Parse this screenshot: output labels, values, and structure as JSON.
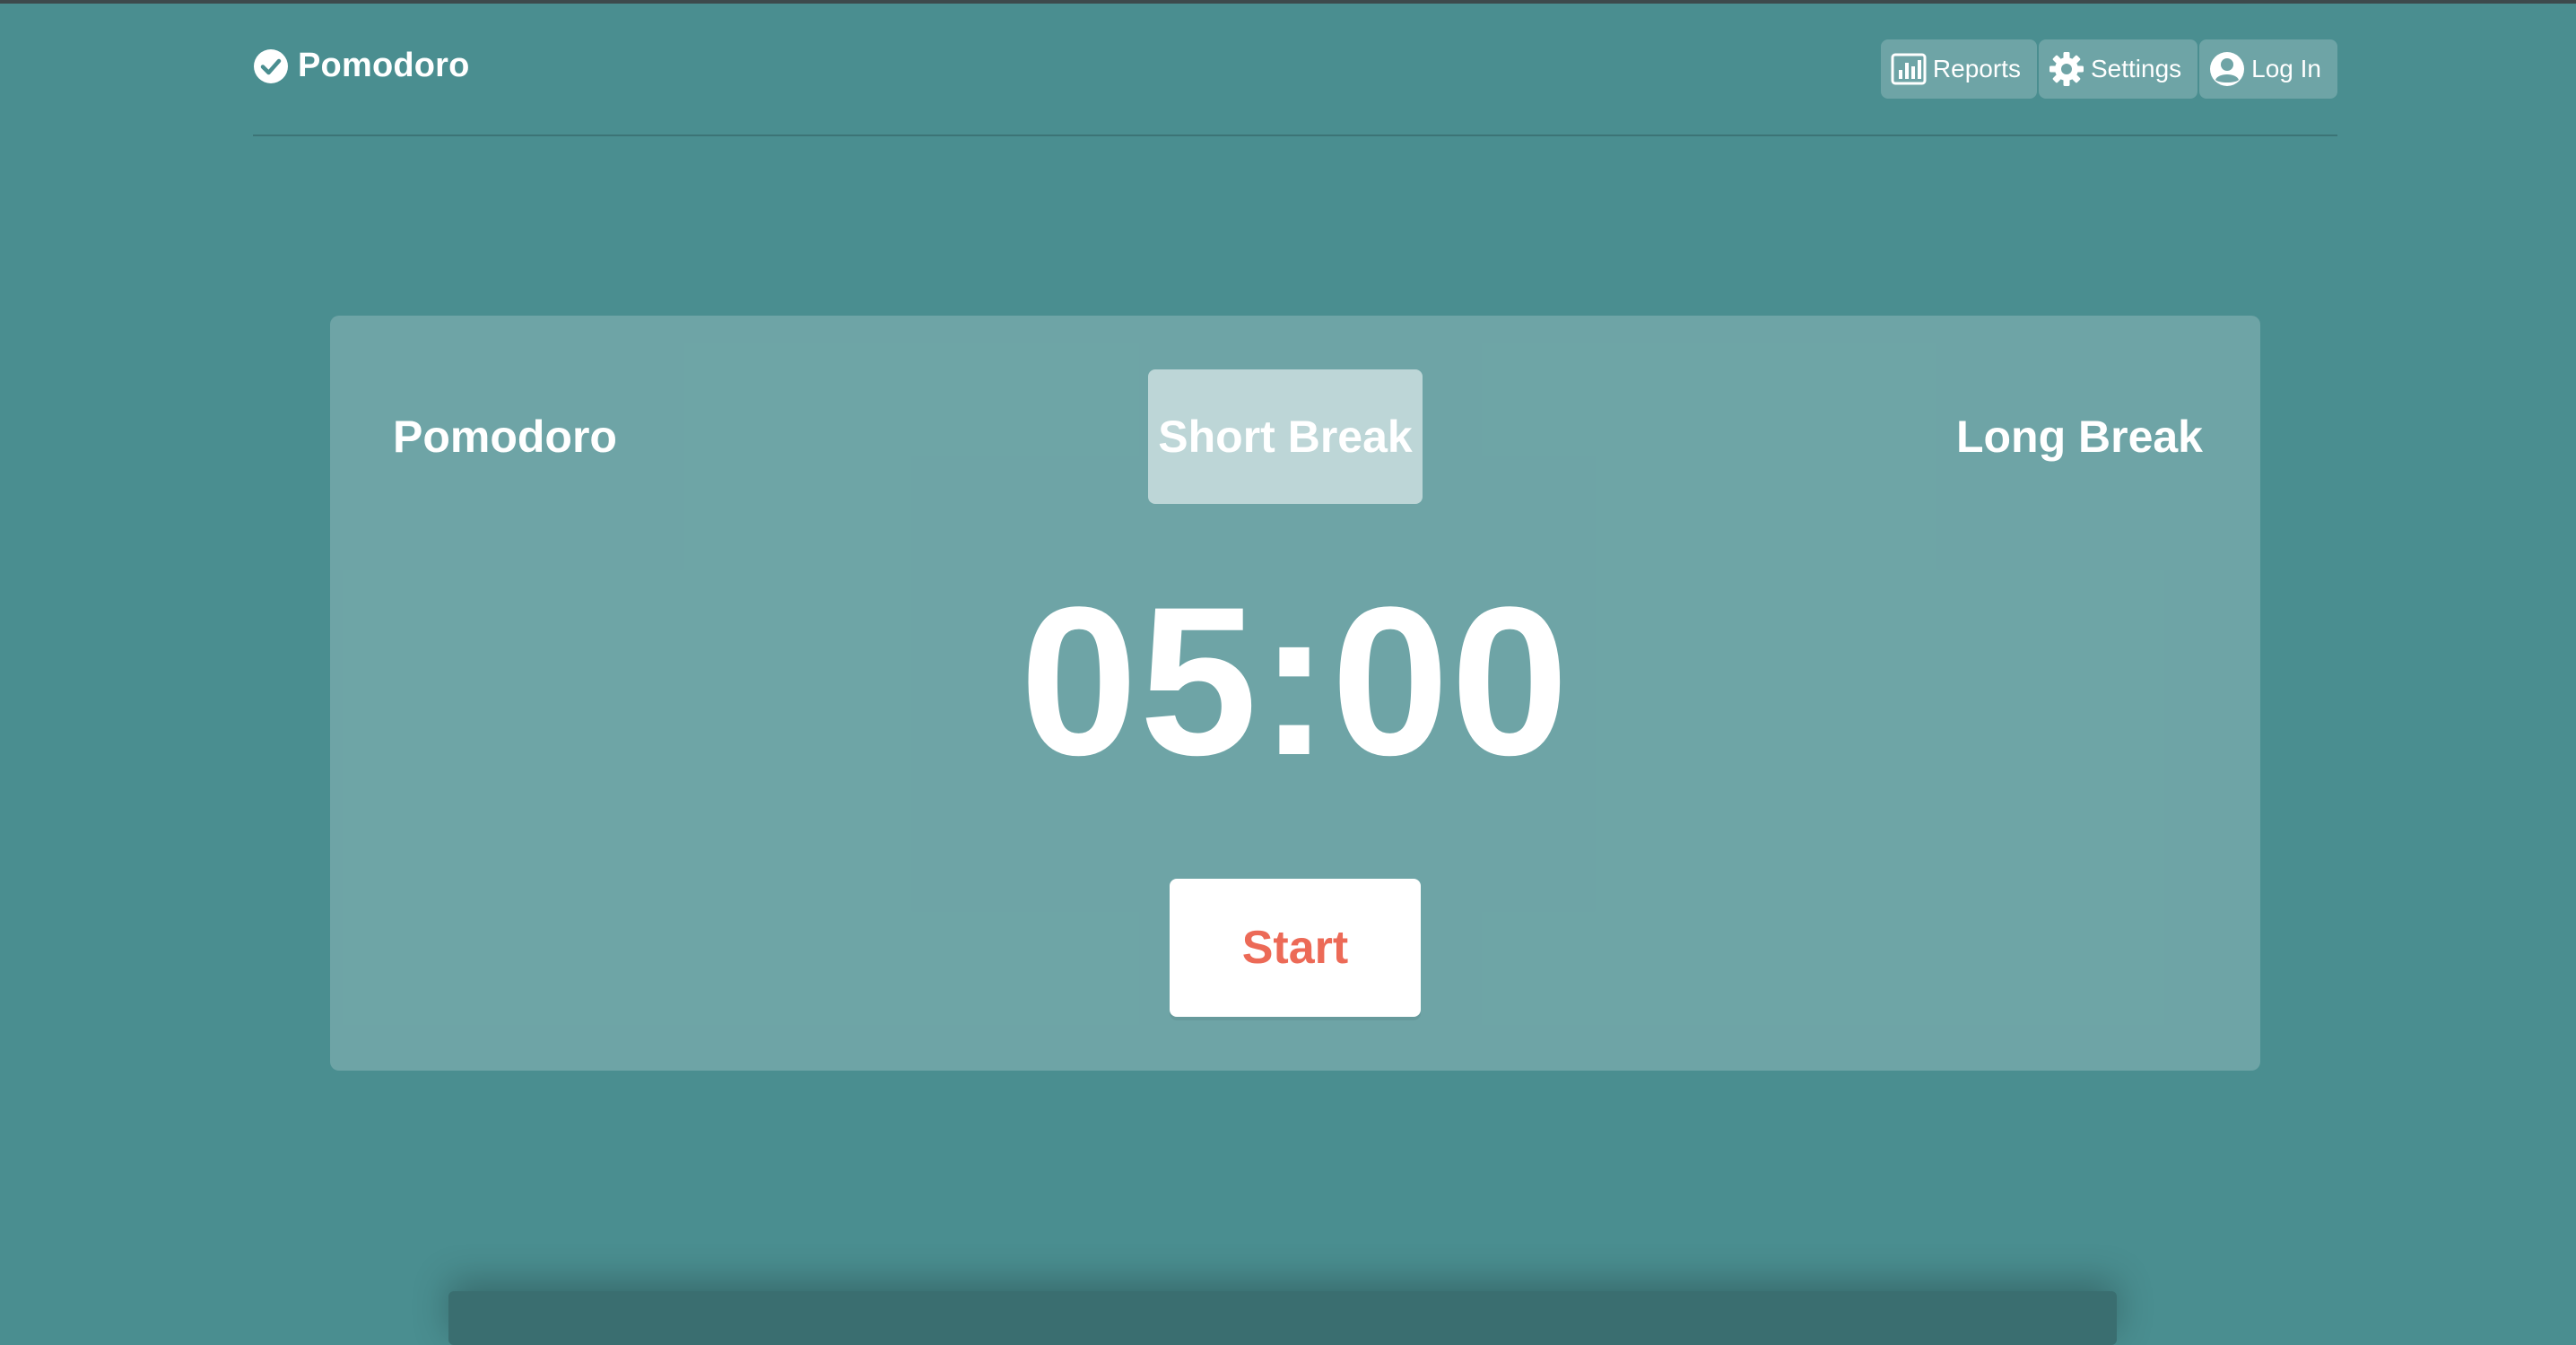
{
  "brand": {
    "title": "Pomodoro",
    "icon": "check-circle-icon"
  },
  "nav": {
    "reports_label": "Reports",
    "settings_label": "Settings",
    "login_label": "Log In",
    "reports_icon": "bar-chart-icon",
    "settings_icon": "gear-icon",
    "login_icon": "user-circle-icon"
  },
  "modes": {
    "items": [
      {
        "label": "Pomodoro",
        "active": false
      },
      {
        "label": "Short Break",
        "active": true
      },
      {
        "label": "Long Break",
        "active": false
      }
    ]
  },
  "timer": {
    "display": "05:00"
  },
  "controls": {
    "start_label": "Start"
  },
  "colors": {
    "background": "#4a8e90",
    "start_text": "#ec6a57",
    "card_overlay": "rgba(255,255,255,0.2)"
  }
}
